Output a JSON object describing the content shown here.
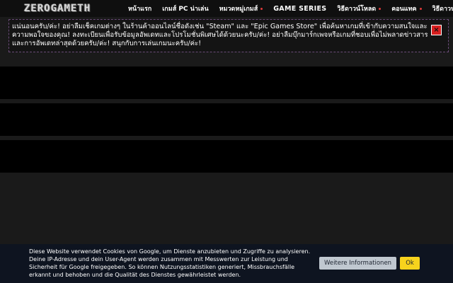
{
  "header": {
    "logo": "ZEROGAMETH",
    "menu": [
      {
        "label": "หน้าแรก",
        "has_dot": false
      },
      {
        "label": "เกมส์ PC น่าเล่น",
        "has_dot": false
      },
      {
        "label": "หมวดหมู่เกมส์",
        "has_dot": true
      },
      {
        "label": "GAME SERIES",
        "has_dot": false
      },
      {
        "label": "วิธีดาวน์โหลด",
        "has_dot": true
      },
      {
        "label": "คอนแทค",
        "has_dot": true
      },
      {
        "label": "วิธีดาวน์โหลด",
        "has_dot": false
      }
    ]
  },
  "notice": {
    "text": "แน่นอนครับ/ค่ะ! อย่าลืมเช็คเกมต่างๆ ในร้านค้าออนไลน์ชื่อดังเช่น \"Steam\" และ \"Epic Games Store\" เพื่อค้นหาเกมที่เข้ากับความสนใจและความพอใจของคุณ! ลงทะเบียนเพื่อรับข้อมูลอัพเดทและโปรโมชั่นพิเศษได้ด้วยนะครับ/ค่ะ! อย่าลืมบุ๊กมาร์กเพจหรือเกมที่ชอบเพื่อไม่พลาดข่าวสารและการอัพเดทล่าสุดด้วยครับ/ค่ะ! สนุกกับการเล่นเกมนะครับ/ค่ะ!",
    "close_label": "×"
  },
  "cookie": {
    "text": "Diese Website verwendet Cookies von Google, um Dienste anzubieten und Zugriffe zu analysieren. Deine IP-Adresse und dein User-Agent werden zusammen mit Messwerten zur Leistung und Sicherheit für Google freigegeben. So können Nutzungsstatistiken generiert, Missbrauchsfälle erkannt und behoben und die Qualität des Dienstes gewährleistet werden.",
    "info_label": "Weitere Informationen",
    "ok_label": "Ok"
  },
  "colors": {
    "accent_dot": "#e03a3a",
    "close_bg": "#d81f1f",
    "ok_bg": "#f7d31d",
    "info_bg": "#c0c8d0"
  }
}
